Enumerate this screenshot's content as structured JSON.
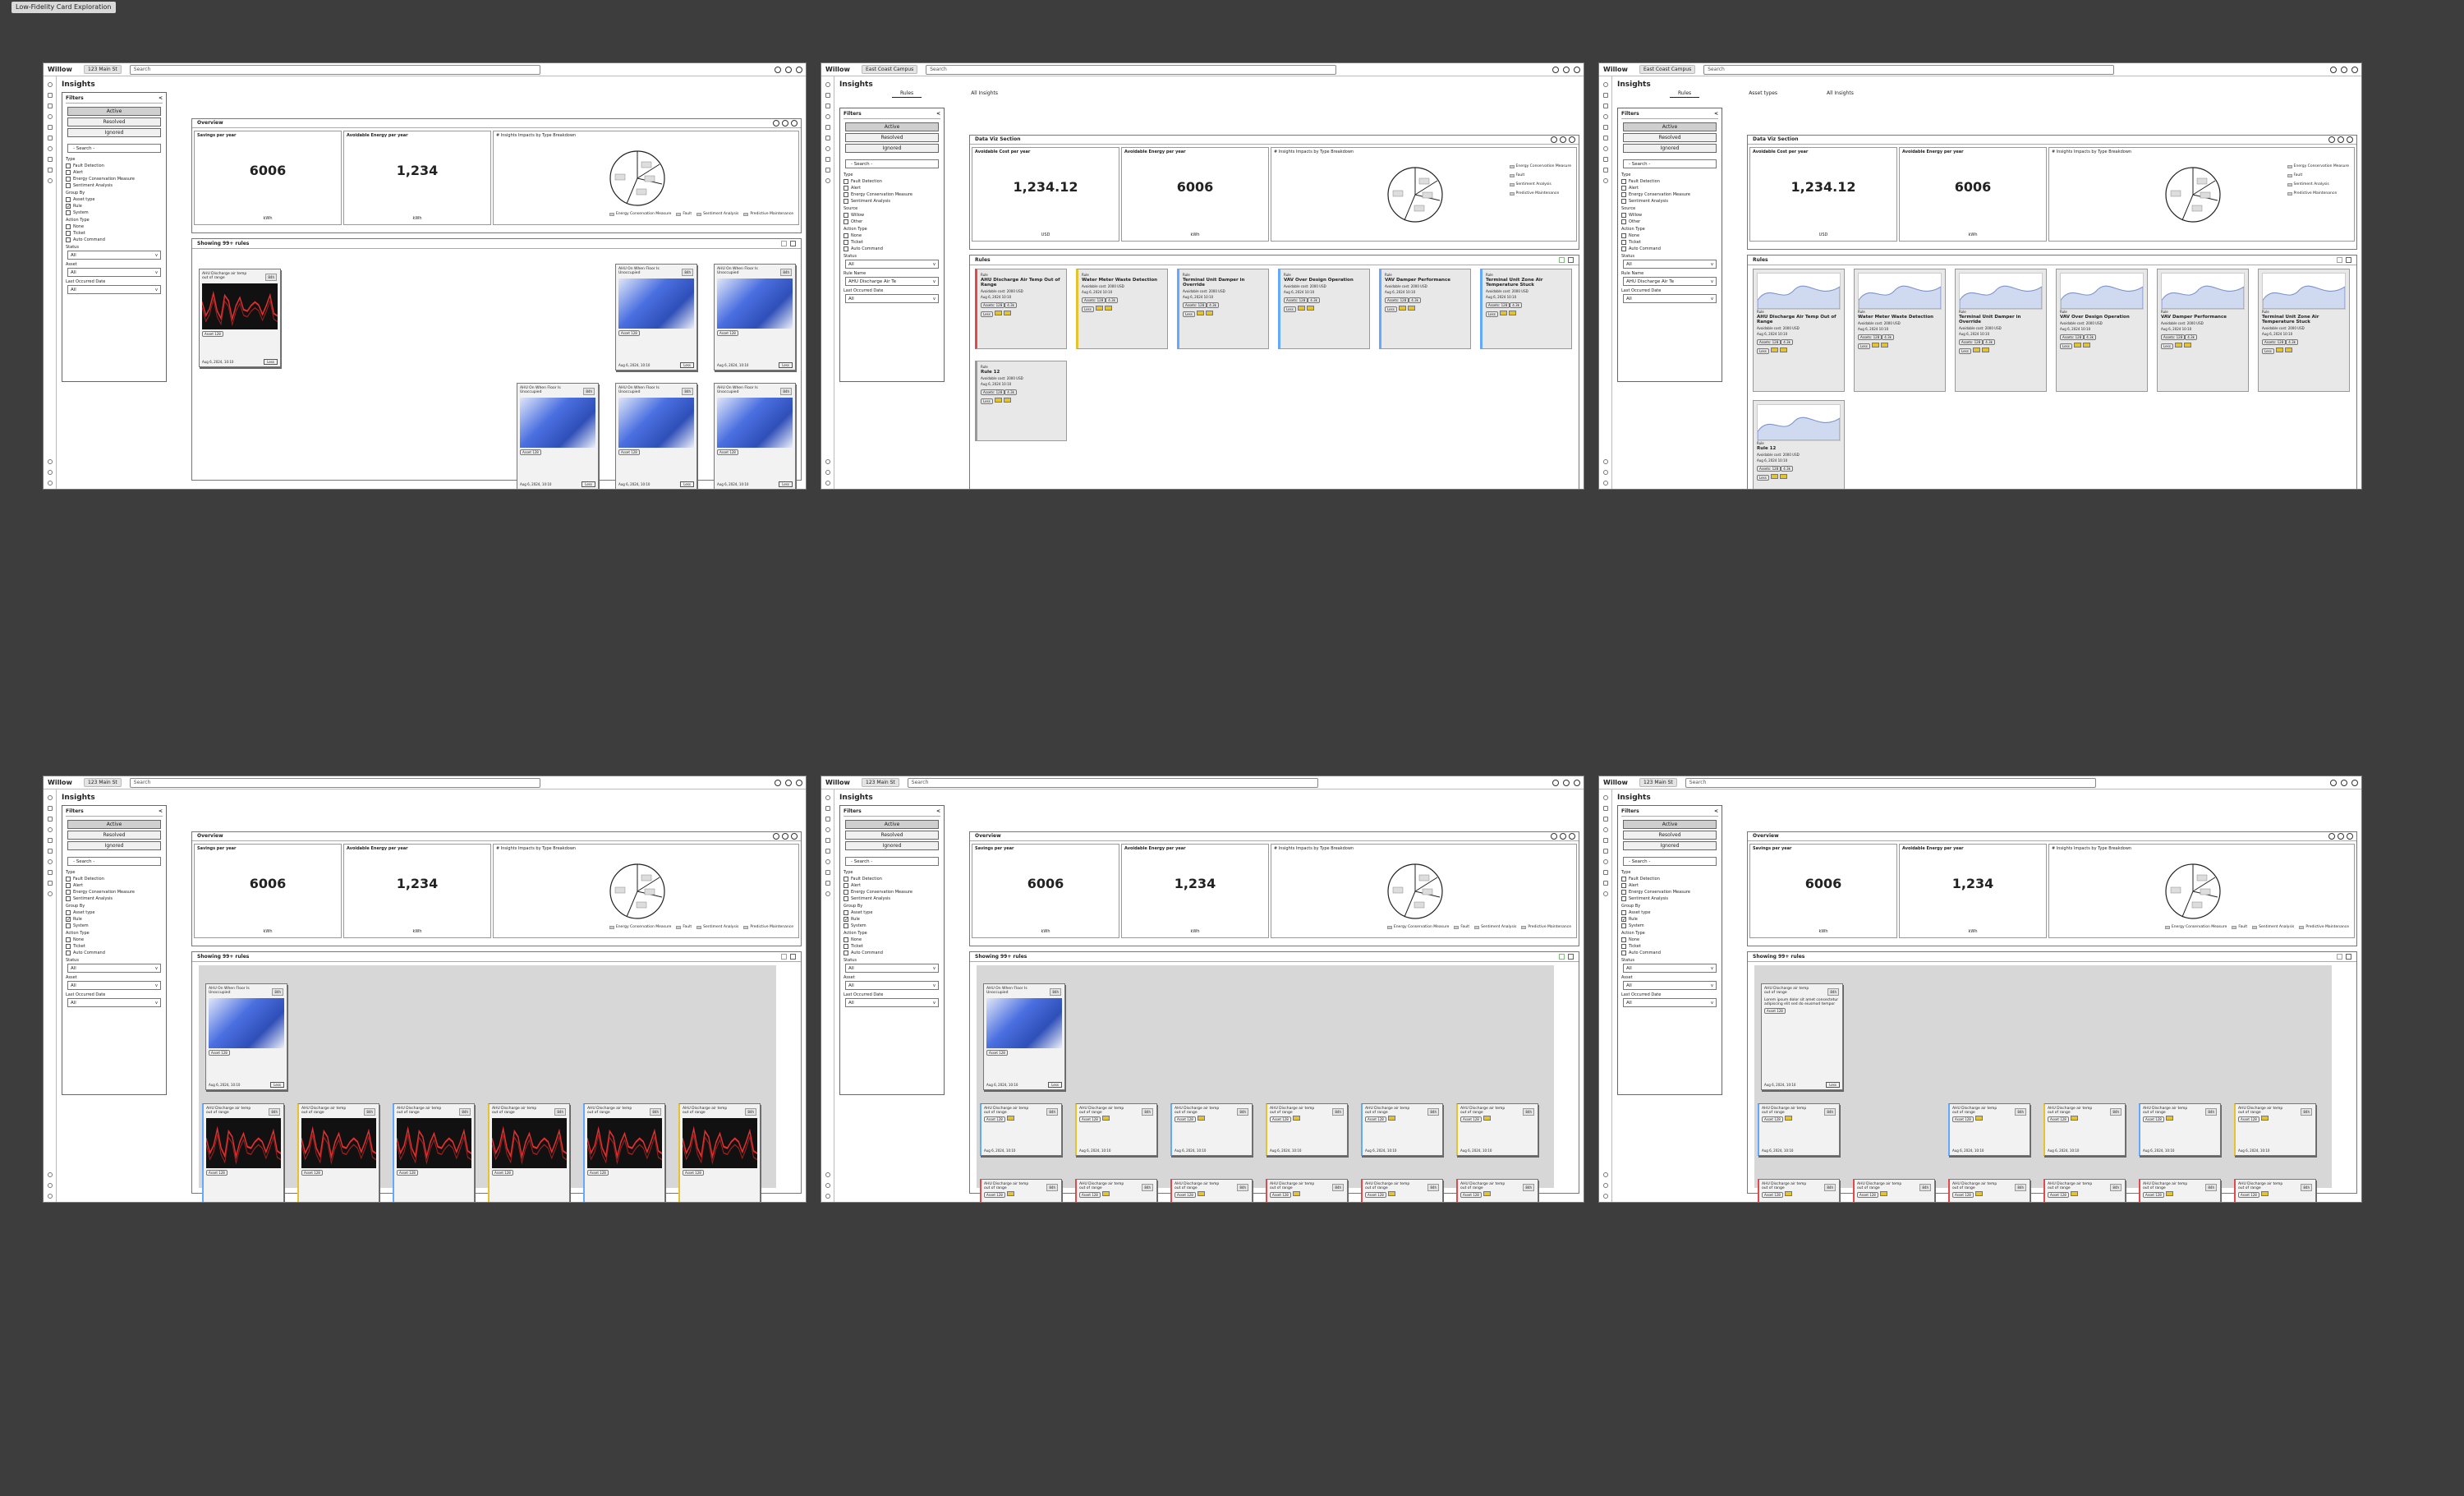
{
  "doc_tab": "Low-Fidelity Card Exploration",
  "common": {
    "brand": "Willow",
    "search_placeholder": "Search",
    "page_title": "Insights",
    "filters_title": "Filters",
    "status_buttons": [
      "Active",
      "Resolved",
      "Ignored"
    ],
    "filter_search": "- Search -",
    "type_label": "Type",
    "type_options": [
      "Fault Detection",
      "Alert",
      "Energy Conservation Measure",
      "Sentiment Analysis"
    ],
    "group_by_label": "Group By",
    "group_by_options": [
      "Asset type",
      "Rule",
      "System"
    ],
    "action_type_label": "Action Type",
    "action_type_options": [
      "None",
      "Ticket",
      "Auto Command"
    ],
    "status_label": "Status",
    "asset_label": "Asset",
    "last_occurred_label": "Last Occurred Date",
    "all": "All",
    "overview_label": "Overview",
    "savings_label": "Savings per year",
    "savings_value": "6006",
    "savings_unit": "kWh",
    "avoidable_label": "Avoidable Energy per year",
    "avoidable_value": "1,234",
    "avoidable_unit": "kWh",
    "pie_label": "# Insights Impacts by Type Breakdown",
    "legend": [
      "Energy Conservation Measure",
      "Fault",
      "Sentiment Analysis",
      "Predictive Maintenance"
    ],
    "showing": "Showing 99+ rules"
  },
  "frames": [
    {
      "site": "123 Main St"
    },
    {
      "site": "East Coast Campus",
      "tabs": [
        "Rules",
        "All Insights"
      ],
      "section": "Data Viz Section",
      "cost_label": "Avoidable Cost per year",
      "cost_value": "1,234.12",
      "cost_unit": "USD",
      "rules_label": "Rules",
      "source_label": "Source",
      "source_options": [
        "Willow",
        "Other"
      ],
      "rule_name_label": "Rule Name",
      "rule_name_value": "AHU Discharge Air Te"
    },
    {
      "site": "East Coast Campus",
      "tabs": [
        "Rules",
        "Asset types",
        "All Insights"
      ],
      "section": "Data Viz Section",
      "cost_label": "Avoidable Cost per year",
      "cost_value": "1,234.12",
      "cost_unit": "USD",
      "rules_label": "Rules",
      "source_label": "Source",
      "source_options": [
        "Willow",
        "Other"
      ],
      "rule_name_label": "Rule Name",
      "rule_name_value": "AHU Discharge Air Te"
    },
    {
      "site": "123 Main St"
    },
    {
      "site": "123 Main St"
    },
    {
      "site": "123 Main St"
    }
  ],
  "card": {
    "title": "AHU Discharge air temp out of range",
    "badge": "84h",
    "asset": "Asset 128",
    "date": "Aug 6, 2024, 10:10",
    "button": "Less",
    "alt_title": "AHU On When Floor Is Unoccupied",
    "lorem": "Lorem ipsum dolor sit amet consectetur adipiscing elit sed do eiusmod tempor"
  },
  "rules": [
    {
      "kind": "Rule",
      "title": "AHU Discharge Air Temp Out of Range",
      "color": "#e04a4a"
    },
    {
      "kind": "Rule",
      "title": "Water Meter Waste Detection",
      "color": "#e5c32c"
    },
    {
      "kind": "Rule",
      "title": "Terminal Unit Damper in Override",
      "color": "#62a9ff"
    },
    {
      "kind": "Rule",
      "title": "VAV Over Design Operation",
      "color": "#62a9ff"
    },
    {
      "kind": "Rule",
      "title": "VAV Damper Performance",
      "color": "#62a9ff"
    },
    {
      "kind": "Rule",
      "title": "Terminal Unit Zone Air Temperature Stuck",
      "color": "#62a9ff"
    },
    {
      "kind": "Rule",
      "title": "Rule 12",
      "color": "#999999"
    }
  ],
  "rule_card_meta": {
    "avoidable": "Avoidable cost: 2000 USD",
    "occurred": "Aug 6, 2024 10:10",
    "assets": "Assets: 128",
    "count": "4.3k",
    "less": "Less"
  }
}
